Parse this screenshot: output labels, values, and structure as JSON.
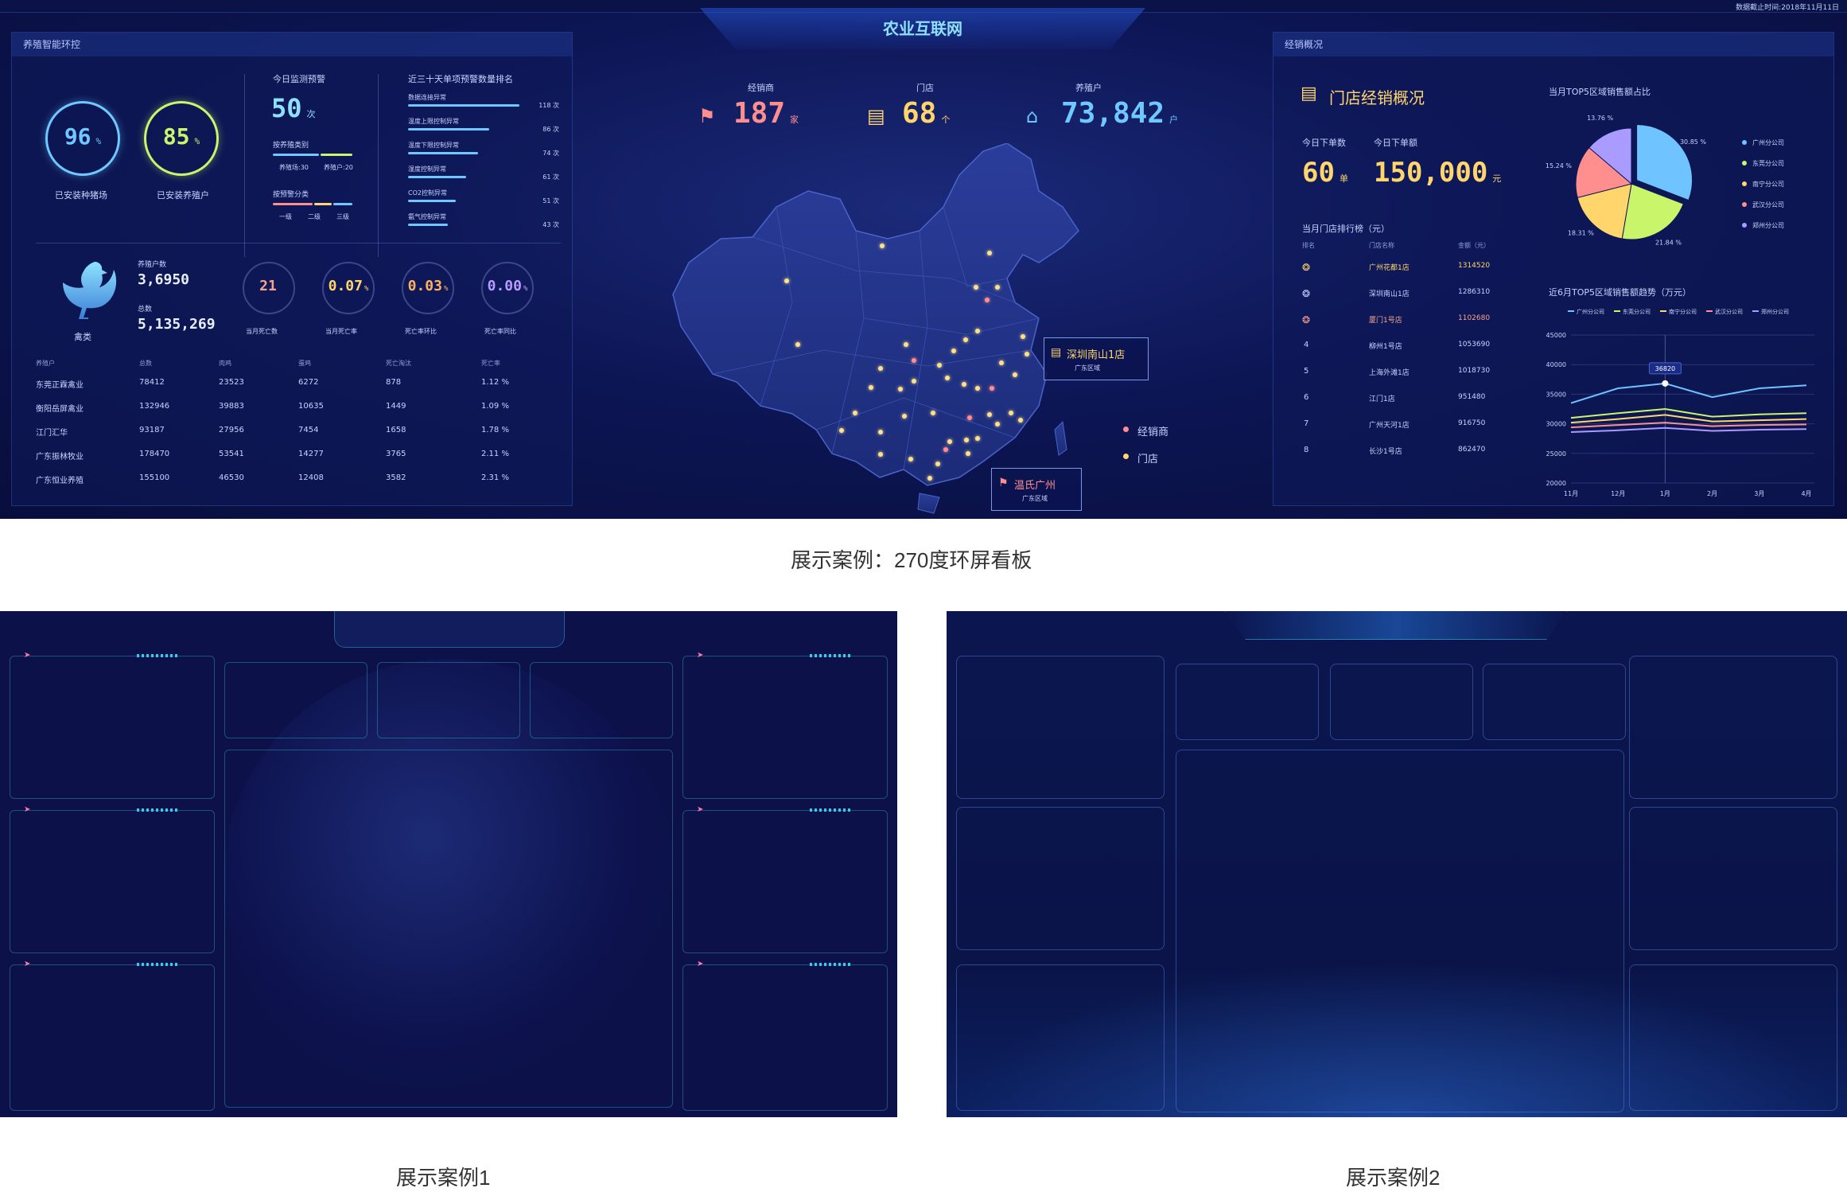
{
  "top": {
    "title": "农业互联网",
    "date_label": "数据截止时间:2018年11月11日"
  },
  "left": {
    "title": "养殖智能环控",
    "rings": [
      {
        "value": "96",
        "unit": "%",
        "label": "已安装种猪场",
        "color": "#6fc8ff"
      },
      {
        "value": "85",
        "unit": "%",
        "label": "已安装养殖户",
        "color": "#c9f56a"
      }
    ],
    "monitor": {
      "title": "今日监测预警",
      "value": "50",
      "unit": "次",
      "cat1_title": "按养殖类别",
      "cat1_legend": [
        "养殖场:30",
        "养殖户:20"
      ],
      "cat2_title": "按预警分类",
      "cat2_legend": [
        "一级",
        "二级",
        "三级"
      ]
    },
    "rank": {
      "title": "近三十天单项预警数量排名",
      "items": [
        {
          "name": "数据连接异常",
          "value": "118 次",
          "pct": 1.0
        },
        {
          "name": "温度上限控制异常",
          "value": "86 次",
          "pct": 0.73
        },
        {
          "name": "温度下限控制异常",
          "value": "74 次",
          "pct": 0.63
        },
        {
          "name": "湿度控制异常",
          "value": "61 次",
          "pct": 0.52
        },
        {
          "name": "CO2控制异常",
          "value": "51 次",
          "pct": 0.43
        },
        {
          "name": "氨气控制异常",
          "value": "43 次",
          "pct": 0.36
        }
      ]
    },
    "poultry": {
      "label": "禽类",
      "farmers_label": "养殖户数",
      "farmers": "3,6950",
      "total_label": "总数",
      "total": "5,135,269"
    },
    "stats": [
      {
        "value": "21",
        "unit": "",
        "label": "当月死亡数",
        "color": "#f3a48d"
      },
      {
        "value": "0.07",
        "unit": "%",
        "label": "当月死亡率",
        "color": "#ffd56c"
      },
      {
        "value": "0.03",
        "unit": "%",
        "label": "死亡率环比",
        "color": "#ffb360"
      },
      {
        "value": "0.00",
        "unit": "%",
        "label": "死亡率同比",
        "color": "#b89bff"
      }
    ],
    "table": {
      "headers": [
        "养殖户",
        "总数",
        "肉鸡",
        "蛋鸡",
        "死亡淘汰",
        "死亡率"
      ],
      "rows": [
        [
          "东莞正霖禽业",
          "78412",
          "23523",
          "6272",
          "878",
          "1.12 %"
        ],
        [
          "衡阳岳屏禽业",
          "132946",
          "39883",
          "10635",
          "1449",
          "1.09 %"
        ],
        [
          "江门汇华",
          "93187",
          "27956",
          "7454",
          "1658",
          "1.78 %"
        ],
        [
          "广东振林牧业",
          "178470",
          "53541",
          "14277",
          "3765",
          "2.11 %"
        ],
        [
          "广东恒业养殖",
          "155100",
          "46530",
          "12408",
          "3582",
          "2.31 %"
        ]
      ]
    }
  },
  "center": {
    "kpis": [
      {
        "label": "经销商",
        "value": "187",
        "unit": "家",
        "color": "#ff8f8f",
        "icon": "people-icon"
      },
      {
        "label": "门店",
        "value": "68",
        "unit": "个",
        "color": "#ffd56c",
        "icon": "store-icon"
      },
      {
        "label": "养殖户",
        "value": "73,842",
        "unit": "户",
        "color": "#6fc8ff",
        "icon": "house-icon"
      }
    ],
    "callouts": [
      {
        "name": "深圳南山1店",
        "region": "广东区域"
      },
      {
        "name": "温氏广州",
        "region": "广东区域"
      }
    ],
    "legend": [
      "经销商",
      "门店"
    ]
  },
  "right": {
    "title": "经销概况",
    "overview_title": "门店经销概况",
    "orders_label": "今日下单数",
    "orders": "60",
    "orders_unit": "单",
    "amount_label": "今日下单额",
    "amount": "150,000",
    "amount_unit": "元",
    "rank_title": "当月门店排行榜（元）",
    "rank_headers": [
      "排名",
      "门店名称",
      "金额（元）"
    ],
    "rank_rows": [
      [
        "1",
        "广州花都1店",
        "1314520"
      ],
      [
        "2",
        "深圳南山1店",
        "1286310"
      ],
      [
        "3",
        "厦门1号店",
        "1102680"
      ],
      [
        "4",
        "柳州1号店",
        "1053690"
      ],
      [
        "5",
        "上海外滩1店",
        "1018730"
      ],
      [
        "6",
        "江门1店",
        "951480"
      ],
      [
        "7",
        "广州天河1店",
        "916750"
      ],
      [
        "8",
        "长沙1号店",
        "862470"
      ]
    ],
    "pie": {
      "title": "当月TOP5区域销售额占比",
      "labels": [
        "30.85 %",
        "21.84 %",
        "18.31 %",
        "15.24 %",
        "13.76 %"
      ],
      "legend": [
        "广州分公司",
        "东莞分公司",
        "南宁分公司",
        "武汉分公司",
        "郑州分公司"
      ],
      "colors": [
        "#6fc3ff",
        "#c9f56a",
        "#ffd56c",
        "#ff8f8f",
        "#a99bff"
      ]
    },
    "trend": {
      "title": "近6月TOP5区域销售额趋势（万元）",
      "legend": [
        "广州分公司",
        "东莞分公司",
        "南宁分公司",
        "武汉分公司",
        "郑州分公司"
      ],
      "x": [
        "11月",
        "12月",
        "1月",
        "2月",
        "3月",
        "4月"
      ],
      "y": [
        "45000",
        "40000",
        "35000",
        "30000",
        "25000",
        "20000"
      ],
      "tooltip": "36820"
    }
  },
  "chart_data": [
    {
      "type": "pie",
      "title": "当月TOP5区域销售额占比",
      "categories": [
        "广州分公司",
        "东莞分公司",
        "南宁分公司",
        "武汉分公司",
        "郑州分公司"
      ],
      "values": [
        30.85,
        21.84,
        18.31,
        15.24,
        13.76
      ]
    },
    {
      "type": "line",
      "title": "近6月TOP5区域销售额趋势（万元）",
      "categories": [
        "11月",
        "12月",
        "1月",
        "2月",
        "3月",
        "4月"
      ],
      "ylim": [
        20000,
        45000
      ],
      "series": [
        {
          "name": "广州分公司",
          "values": [
            33500,
            36000,
            36820,
            34500,
            36000,
            36500
          ]
        },
        {
          "name": "东莞分公司",
          "values": [
            31000,
            31800,
            32500,
            31200,
            31600,
            31800
          ]
        },
        {
          "name": "南宁分公司",
          "values": [
            30200,
            30800,
            31500,
            30400,
            30600,
            30800
          ]
        },
        {
          "name": "武汉分公司",
          "values": [
            29400,
            29800,
            30200,
            29600,
            29800,
            29900
          ]
        },
        {
          "name": "郑州分公司",
          "values": [
            28600,
            28900,
            29300,
            28800,
            29000,
            29100
          ]
        }
      ]
    }
  ],
  "captions": {
    "main": "展示案例：270度环屏看板",
    "sample1": "展示案例1",
    "sample2": "展示案例2"
  }
}
